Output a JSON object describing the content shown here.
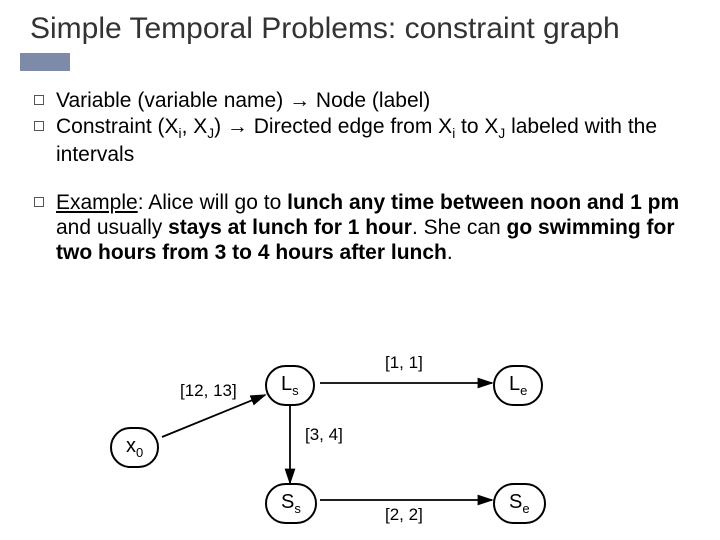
{
  "title": "Simple Temporal Problems: constraint graph",
  "bullets": {
    "b1_pre": "Variable (variable name) ",
    "b1_post": " Node (label)",
    "b2_a": "Constraint (X",
    "b2_b": ", X",
    "b2_c": ") ",
    "b2_d": " Directed edge from X",
    "b2_e": " to  X",
    "b2_f": " labeled with the intervals",
    "sub_i": "i",
    "sub_J": "J",
    "arrow": "→",
    "ex_label": "Example",
    "ex_1": ": Alice will go to ",
    "ex_2": "lunch any time between noon and 1 pm",
    "ex_3": " and usually ",
    "ex_4": "stays at lunch for 1 hour",
    "ex_5": ". She can ",
    "ex_6": "go swimming  for two hours from 3 to 4 hours after lunch",
    "ex_7": "."
  },
  "diagram": {
    "x0": "x",
    "x0_sub": "0",
    "Ls": "L",
    "Ls_sub": "s",
    "Le": "L",
    "Le_sub": "e",
    "Ss": "S",
    "Ss_sub": "s",
    "Se": "S",
    "Se_sub": "e",
    "e_x0_Ls": "[12, 13]",
    "e_Ls_Le": "[1, 1]",
    "e_Ls_Ss": "[3, 4]",
    "e_Ss_Se": "[2, 2]"
  }
}
